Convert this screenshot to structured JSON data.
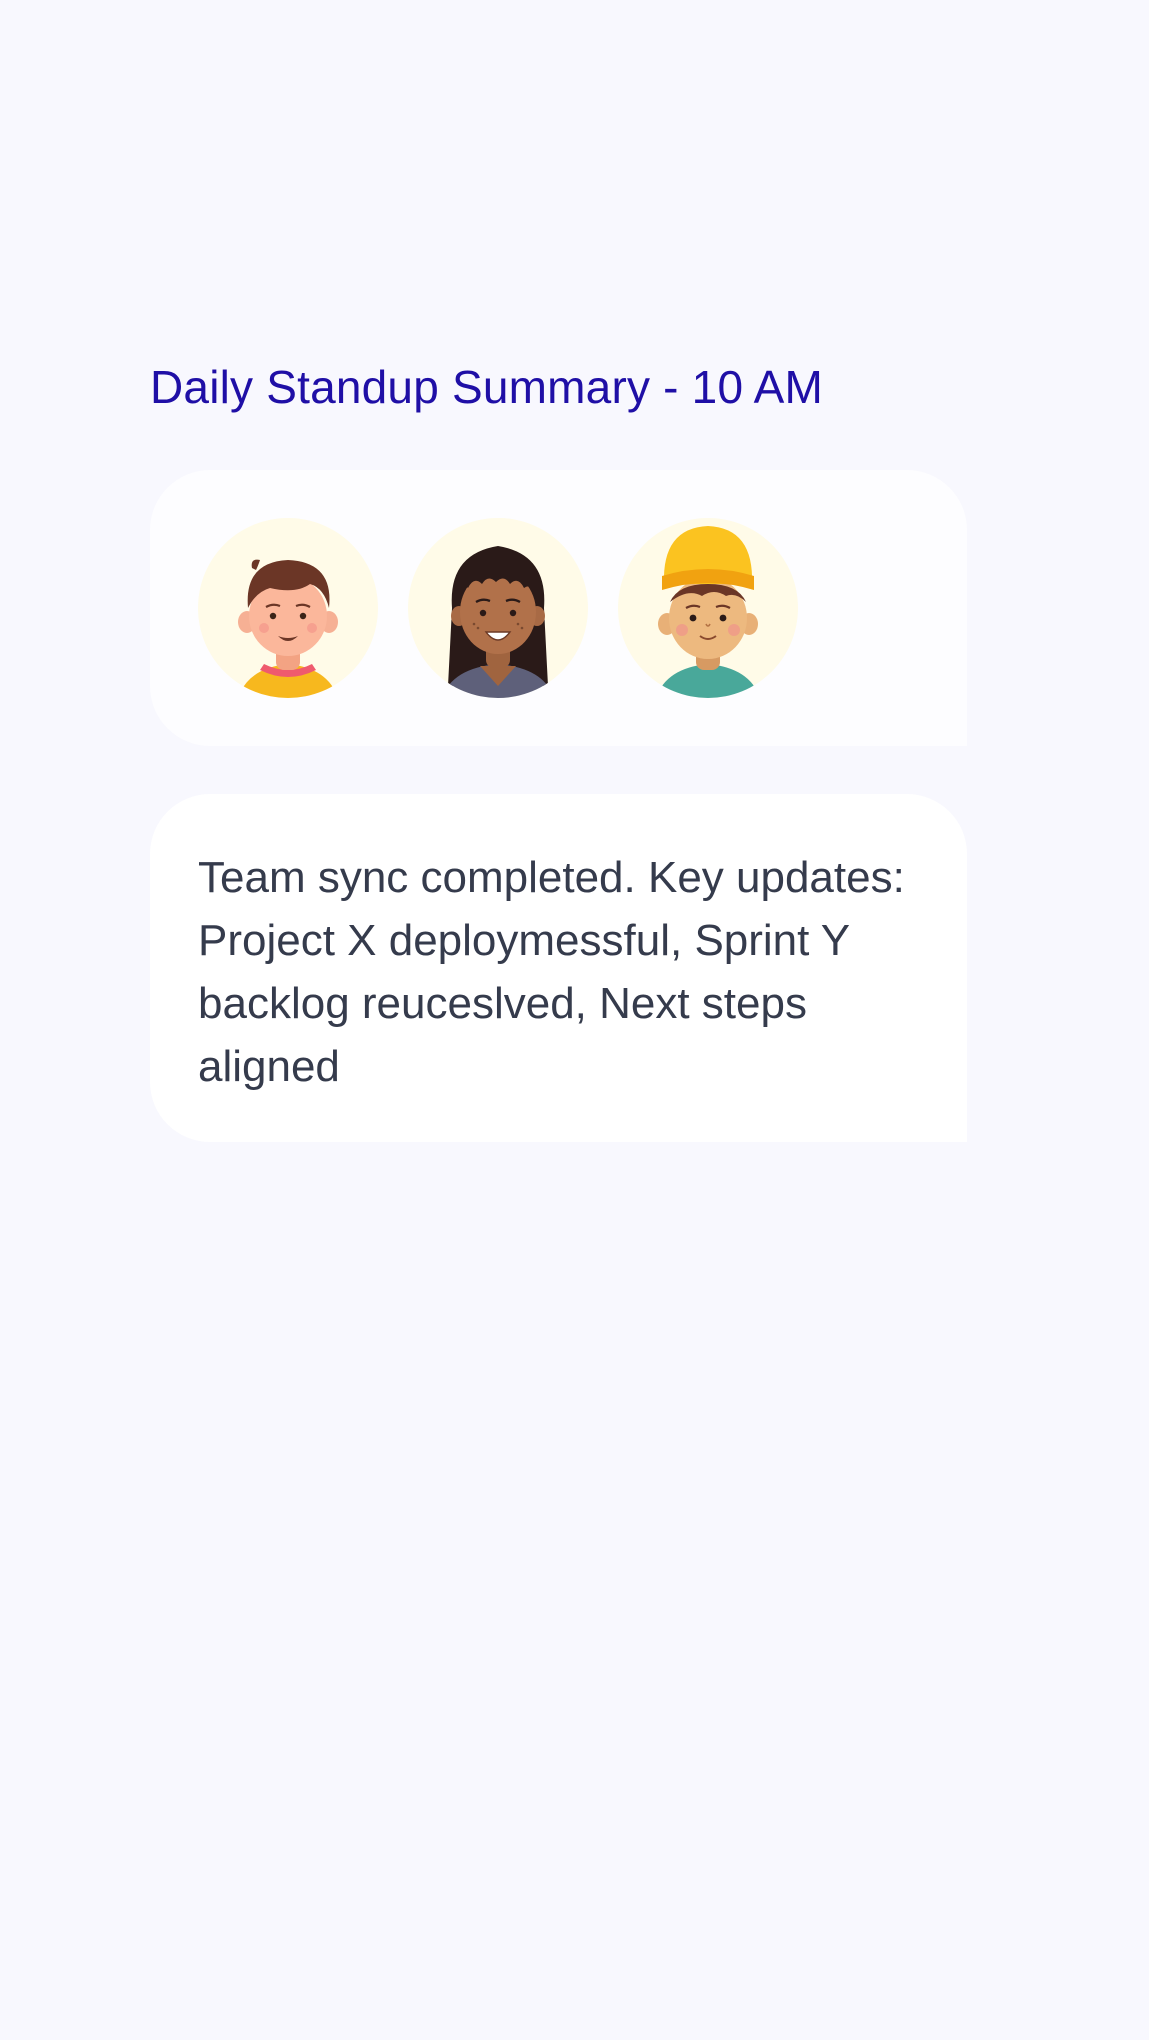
{
  "header": {
    "title": "Daily Standup Summary - 10 AM"
  },
  "participants": [
    {
      "icon": "avatar-boy-brown-hair-yellow-shirt-icon"
    },
    {
      "icon": "avatar-woman-long-dark-hair-icon"
    },
    {
      "icon": "avatar-boy-yellow-beanie-icon"
    }
  ],
  "message": {
    "text": "Team sync completed. Key updates: Project X deploymessful, Sprint Y backlog reuceslved, Next steps aligned"
  },
  "colors": {
    "background": "#f8f8fe",
    "title": "#1f0fa6",
    "card": "#ffffff",
    "body_text": "#353b4c",
    "avatar_bg": "#fffbe8"
  }
}
